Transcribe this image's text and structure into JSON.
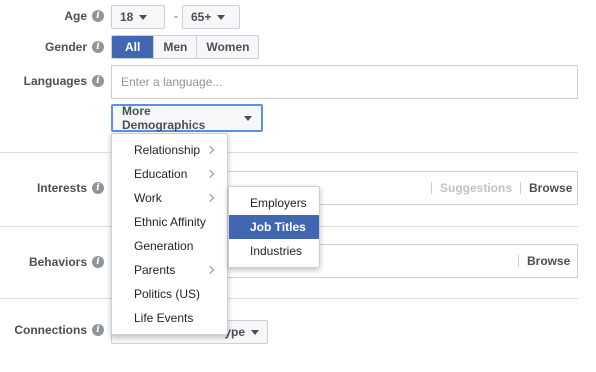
{
  "age": {
    "label": "Age",
    "min": "18",
    "max": "65+",
    "separator": "-"
  },
  "gender": {
    "label": "Gender",
    "options": [
      "All",
      "Men",
      "Women"
    ],
    "selected": "All"
  },
  "languages": {
    "label": "Languages",
    "placeholder": "Enter a language..."
  },
  "more_demographics": {
    "label": "More Demographics"
  },
  "interests": {
    "label": "Interests",
    "suggestions": "Suggestions",
    "browse": "Browse"
  },
  "behaviors": {
    "label": "Behaviors",
    "browse": "Browse"
  },
  "connections": {
    "label": "Connections",
    "partial_dropdown_text": "ype"
  },
  "demographics_menu": {
    "items": [
      {
        "label": "Relationship",
        "has_submenu": true
      },
      {
        "label": "Education",
        "has_submenu": true
      },
      {
        "label": "Work",
        "has_submenu": true
      },
      {
        "label": "Ethnic Affinity",
        "has_submenu": false
      },
      {
        "label": "Generation",
        "has_submenu": false
      },
      {
        "label": "Parents",
        "has_submenu": true
      },
      {
        "label": "Politics (US)",
        "has_submenu": false
      },
      {
        "label": "Life Events",
        "has_submenu": false
      }
    ]
  },
  "work_submenu": {
    "items": [
      "Employers",
      "Job Titles",
      "Industries"
    ],
    "highlighted": "Job Titles"
  },
  "colors": {
    "accent": "#4267b2",
    "focus_border": "#5b90e6"
  }
}
